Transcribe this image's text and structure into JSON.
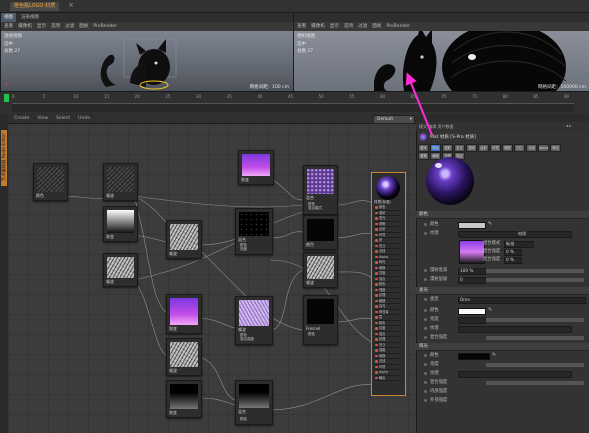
{
  "window": {
    "doc_tab": "橙色瓶LOGO-材质",
    "close_glyph": "×"
  },
  "viewport_left": {
    "tabs": [
      "视图",
      "渲染视图"
    ],
    "menu": [
      "查看",
      "摄像机",
      "显示",
      "选项",
      "过滤",
      "面板",
      "ProRender"
    ],
    "label": "透视视图",
    "stats": [
      "选中",
      "总数 27"
    ],
    "grid_text": "网格间距：100 cm"
  },
  "viewport_right": {
    "menu": [
      "查看",
      "摄像机",
      "显示",
      "选项",
      "过滤",
      "面板",
      "ProRender"
    ],
    "label": "相机视图",
    "stats": [
      "选中",
      "总数 27"
    ],
    "grid_text": "网格间距：100000 cm"
  },
  "timeline": {
    "ticks": [
      "0",
      "5",
      "10",
      "15",
      "20",
      "25",
      "30",
      "35",
      "40",
      "45",
      "50",
      "55",
      "60",
      "65",
      "70",
      "75",
      "80",
      "85",
      "90"
    ],
    "frame_end": "90 F"
  },
  "node_editor": {
    "menu": [
      "Create",
      "View",
      "Select",
      "Undo"
    ],
    "dropdown": "Default",
    "side_tab": "节点编辑器 Node Editor",
    "nodes": [
      {
        "id": "n1",
        "label": "颜色",
        "style": "noise"
      },
      {
        "id": "n2",
        "label": "噪波",
        "style": "noise"
      },
      {
        "id": "n3",
        "label": "渐变",
        "style": "grad-wb"
      },
      {
        "id": "n4",
        "label": "噪波",
        "style": "noise2"
      },
      {
        "id": "n5",
        "label": "噪波",
        "style": "noise2"
      },
      {
        "id": "n6",
        "label": "渐变",
        "style": "grad-purple"
      },
      {
        "id": "n7",
        "label": "混合",
        "style": "black-specks"
      },
      {
        "id": "n8",
        "label": "噪波",
        "style": "noise2"
      },
      {
        "id": "n9",
        "label": "颜色",
        "style": "black"
      },
      {
        "id": "n10",
        "label": "噪波",
        "style": "noise2"
      },
      {
        "id": "n11",
        "label": "混合",
        "style": "dots-purple"
      },
      {
        "id": "n12",
        "label": "渐变",
        "style": "grad-purple"
      },
      {
        "id": "n13",
        "label": "噪波",
        "style": "lilac-noise"
      },
      {
        "id": "n14",
        "label": "噪波",
        "style": "noise2"
      },
      {
        "id": "n15",
        "label": "Fresnel",
        "style": "black"
      },
      {
        "id": "n16",
        "label": "渐变",
        "style": "grad-dark"
      },
      {
        "id": "n17",
        "label": "混合",
        "style": "grad-dark"
      }
    ],
    "material_node": {
      "title": "材质(标准)",
      "ports": [
        "颜色",
        "漫射",
        "发光",
        "透明",
        "反射",
        "环境",
        "雾",
        "凹凸",
        "法线",
        "Alpha",
        "辉光",
        "置换",
        "亮度",
        "混合",
        "颜色",
        "强度",
        "纹理",
        "粗糙",
        "高光",
        "菲涅耳",
        "层",
        "颜色",
        "亮度",
        "混合",
        "纹理",
        "凹凸",
        "强度",
        "置换",
        "法线",
        "环境",
        "Alpha",
        "输出"
      ]
    },
    "small_port_labels": [
      "颜色",
      "亮度",
      "混合模式",
      "混合强度"
    ]
  },
  "attributes": {
    "toolbar_left": "模式 编辑 用户数据",
    "material_name": "Mat 材质 [S-Pro 材质]",
    "mat_buttons": [
      "基本",
      "颜色",
      "漫射",
      "发光",
      "透明",
      "反射",
      "环境",
      "烟雾",
      "凹凸",
      "法线",
      "Alpha",
      "辉光",
      "置换",
      "编辑",
      "光照",
      "指定"
    ],
    "sections": {
      "color": "颜色",
      "specular": "发光",
      "glow": "辉光"
    },
    "rows": {
      "color_label": "颜色",
      "color_value": "",
      "texture_label": "纹理",
      "texture_value": "材质",
      "blend_mode": "混合模式",
      "blend_mode_value": "标准",
      "blend_strength": "混合强度",
      "blend_strength_value": "0 %",
      "mix_label": "混合强度",
      "mix_value": "0 %",
      "mix2_label": "混合强度",
      "mix2_value": "0 %",
      "model_label": "漫射衰减",
      "model_value": "100 %",
      "roughness_label": "漫射层级",
      "roughness_value": "0",
      "spec_type_label": "类型",
      "spec_type_value": "Oren",
      "spec_color_label": "颜色",
      "spec_brightness_label": "亮度",
      "spec_texture_label": "纹理",
      "spec_mix_label": "混合强度",
      "glow_color_label": "颜色",
      "glow_brightness_label": "亮度",
      "glow_texture_label": "纹理",
      "glow_mix_label": "混合强度",
      "glow_inner": "内部强度",
      "glow_outer": "外部强度"
    }
  },
  "colors": {
    "accent_orange": "#f0a53c",
    "arrow_magenta": "#ff2bd6",
    "port_red": "#e0523a",
    "playhead_green": "#23c24d"
  }
}
